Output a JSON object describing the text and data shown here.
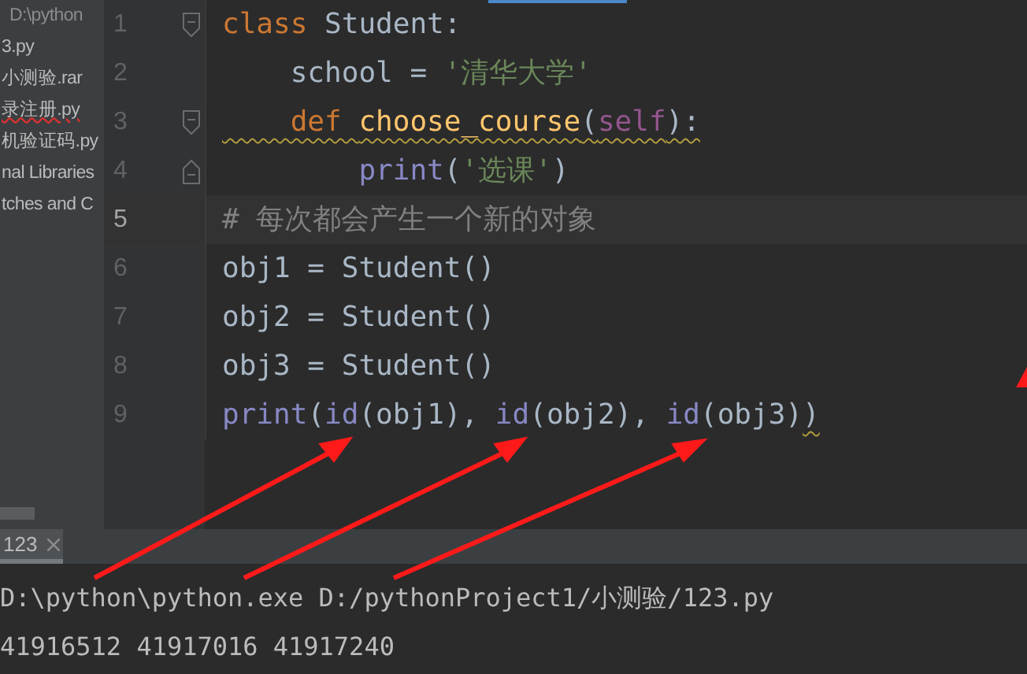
{
  "project_tree": [
    {
      "label": "D:\\python",
      "kind": "path",
      "error": false
    },
    {
      "label": "3.py",
      "kind": "file",
      "error": false
    },
    {
      "label": "小测验.rar",
      "kind": "file",
      "error": false
    },
    {
      "label": "录注册.py",
      "kind": "file",
      "error": true
    },
    {
      "label": "机验证码.py",
      "kind": "file",
      "error": false
    },
    {
      "label": "nal Libraries",
      "kind": "file",
      "error": false
    },
    {
      "label": "tches and C",
      "kind": "file",
      "error": false
    }
  ],
  "editor": {
    "lines": [
      {
        "number": "1",
        "current": false,
        "fold_start": true,
        "fold_end": false,
        "tokens": [
          {
            "text": "class ",
            "kind": "keyword",
            "wavy": false
          },
          {
            "text": "Student:",
            "kind": "plain",
            "wavy": false
          }
        ]
      },
      {
        "number": "2",
        "current": false,
        "fold_start": false,
        "fold_end": false,
        "tokens": [
          {
            "text": "    school = ",
            "kind": "plain",
            "wavy": false
          },
          {
            "text": "'清华大学'",
            "kind": "string",
            "wavy": false
          }
        ]
      },
      {
        "number": "3",
        "current": false,
        "fold_start": true,
        "fold_end": false,
        "tokens": [
          {
            "text": "    def ",
            "kind": "keyword",
            "wavy": true
          },
          {
            "text": "choose_course",
            "kind": "funcdef",
            "wavy": true
          },
          {
            "text": "(",
            "kind": "plain",
            "wavy": true
          },
          {
            "text": "self",
            "kind": "self",
            "wavy": true
          },
          {
            "text": "):",
            "kind": "plain",
            "wavy": true
          }
        ]
      },
      {
        "number": "4",
        "current": false,
        "fold_start": false,
        "fold_end": true,
        "tokens": [
          {
            "text": "        print",
            "kind": "builtin",
            "wavy": false
          },
          {
            "text": "(",
            "kind": "plain",
            "wavy": false
          },
          {
            "text": "'选课'",
            "kind": "string",
            "wavy": false
          },
          {
            "text": ")",
            "kind": "plain",
            "wavy": false
          }
        ]
      },
      {
        "number": "5",
        "current": true,
        "fold_start": false,
        "fold_end": false,
        "tokens": [
          {
            "text": "# 每次都会产生一个新的对象",
            "kind": "comment",
            "wavy": false
          }
        ]
      },
      {
        "number": "6",
        "current": false,
        "fold_start": false,
        "fold_end": false,
        "tokens": [
          {
            "text": "obj1 = Student()",
            "kind": "plain",
            "wavy": false
          }
        ]
      },
      {
        "number": "7",
        "current": false,
        "fold_start": false,
        "fold_end": false,
        "tokens": [
          {
            "text": "obj2 = Student()",
            "kind": "plain",
            "wavy": false
          }
        ]
      },
      {
        "number": "8",
        "current": false,
        "fold_start": false,
        "fold_end": false,
        "tokens": [
          {
            "text": "obj3 = Student()",
            "kind": "plain",
            "wavy": false
          }
        ]
      },
      {
        "number": "9",
        "current": false,
        "fold_start": false,
        "fold_end": false,
        "tokens": [
          {
            "text": "print",
            "kind": "builtin",
            "wavy": false
          },
          {
            "text": "(",
            "kind": "plain",
            "wavy": false
          },
          {
            "text": "id",
            "kind": "builtin",
            "wavy": false
          },
          {
            "text": "(obj1), ",
            "kind": "plain",
            "wavy": false
          },
          {
            "text": "id",
            "kind": "builtin",
            "wavy": false
          },
          {
            "text": "(obj2), ",
            "kind": "plain",
            "wavy": false
          },
          {
            "text": "id",
            "kind": "builtin",
            "wavy": false
          },
          {
            "text": "(obj3)",
            "kind": "plain",
            "wavy": false
          },
          {
            "text": ")",
            "kind": "plain",
            "wavy": true
          }
        ]
      }
    ]
  },
  "run_panel": {
    "tabs": [
      {
        "label": "123",
        "selected": true
      }
    ],
    "output": [
      "D:\\python\\python.exe D:/pythonProject1/小测验/123.py",
      "41916512 41917016 41917240"
    ]
  }
}
